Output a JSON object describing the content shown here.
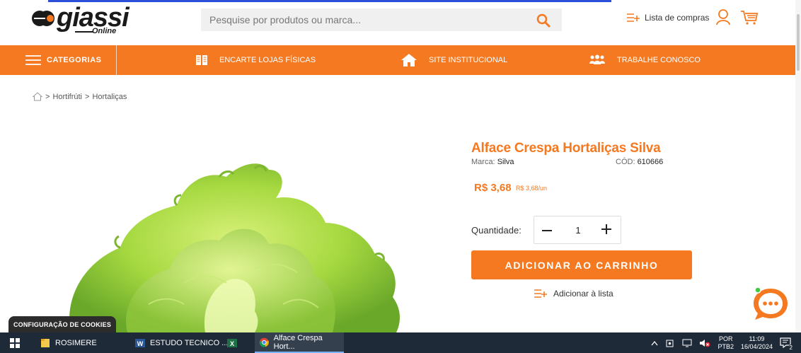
{
  "header": {
    "logo_text": "giassi",
    "logo_sub": "Online",
    "search_placeholder": "Pesquise por produtos ou marca...",
    "shopping_list_label": "Lista de compras"
  },
  "nav": {
    "categories_label": "CATEGORIAS",
    "items": [
      {
        "label": "ENCARTE LOJAS FÍSICAS",
        "icon": "book-icon"
      },
      {
        "label": "SITE INSTITUCIONAL",
        "icon": "home-icon"
      },
      {
        "label": "TRABALHE CONOSCO",
        "icon": "people-icon"
      }
    ]
  },
  "breadcrumb": {
    "items": [
      "Hortifrúti",
      "Hortaliças"
    ],
    "separator": ">"
  },
  "product": {
    "title": "Alface Crespa Hortaliças Silva",
    "brand_label": "Marca:",
    "brand_value": "Silva",
    "code_label": "CÓD:",
    "code_value": "610666",
    "price": "R$ 3,68",
    "unit_price": "R$ 3,68/un",
    "quantity_label": "Quantidade:",
    "quantity": "1",
    "add_to_cart_label": "ADICIONAR AO CARRINHO",
    "add_to_list_label": "Adicionar à lista"
  },
  "cookie": {
    "label": "CONFIGURAÇÃO DE COOKIES"
  },
  "taskbar": {
    "items": [
      {
        "label": "ROSIMERE",
        "icon": "folder-icon"
      },
      {
        "label": "ESTUDO TECNICO ...",
        "icon": "word-icon"
      },
      {
        "label": "",
        "icon": "excel-icon"
      },
      {
        "label": "Alface Crespa Hort...",
        "icon": "chrome-icon"
      }
    ],
    "lang_top": "POR",
    "lang_bottom": "PTB2",
    "time": "11:09",
    "date": "16/04/2024",
    "notification_count": "2"
  },
  "colors": {
    "brand_orange": "#f47920",
    "taskbar": "#1f2a38"
  }
}
